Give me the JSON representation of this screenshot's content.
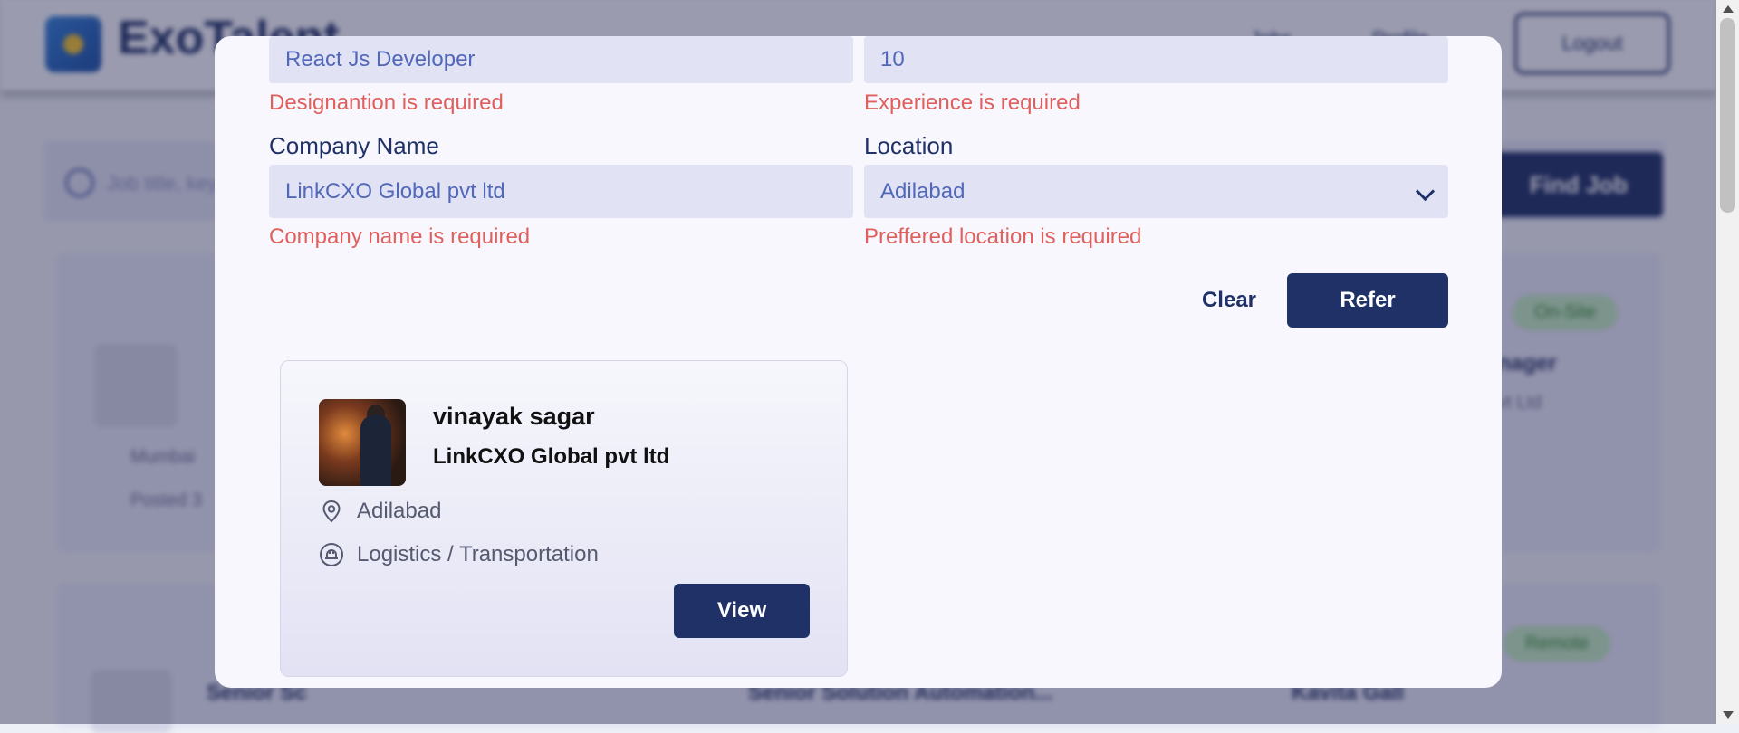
{
  "background": {
    "brand": "ExoTalent",
    "nav": [
      "Jobs",
      "Profile"
    ],
    "logout_label": "Logout",
    "search_placeholder": "Job title, keywords...",
    "find_job_label": "Find Job",
    "cards": [
      {
        "badge": "On-Site",
        "title": "Manager",
        "subtitle": "Pvt Ltd",
        "location": "Mumbai",
        "posted": "Posted 3"
      },
      {
        "badge": "Remote",
        "title": "Senior Solution Automation...",
        "subtitle": "Senior Sc",
        "extra": "Kavita Gall"
      }
    ]
  },
  "modal": {
    "designation_value": "React Js Developer",
    "designation_error": "Designantion is required",
    "experience_value": "10",
    "experience_error": "Experience is required",
    "company_label": "Company Name",
    "company_value": "LinkCXO Global pvt ltd",
    "company_error": "Company name is required",
    "location_label": "Location",
    "location_value": "Adilabad",
    "location_error": "Preffered location is required",
    "clear_label": "Clear",
    "refer_label": "Refer",
    "candidate": {
      "name": "vinayak sagar",
      "company": "LinkCXO Global pvt ltd",
      "location": "Adilabad",
      "industry": "Logistics / Transportation",
      "view_label": "View"
    }
  },
  "icons": {
    "location": "map-pin-icon",
    "industry": "industry-icon",
    "chevron": "chevron-down-icon"
  },
  "colors": {
    "primary": "#1f3166",
    "error": "#e0605e",
    "field_bg": "#e2e2f5",
    "field_text": "#5168b8"
  }
}
